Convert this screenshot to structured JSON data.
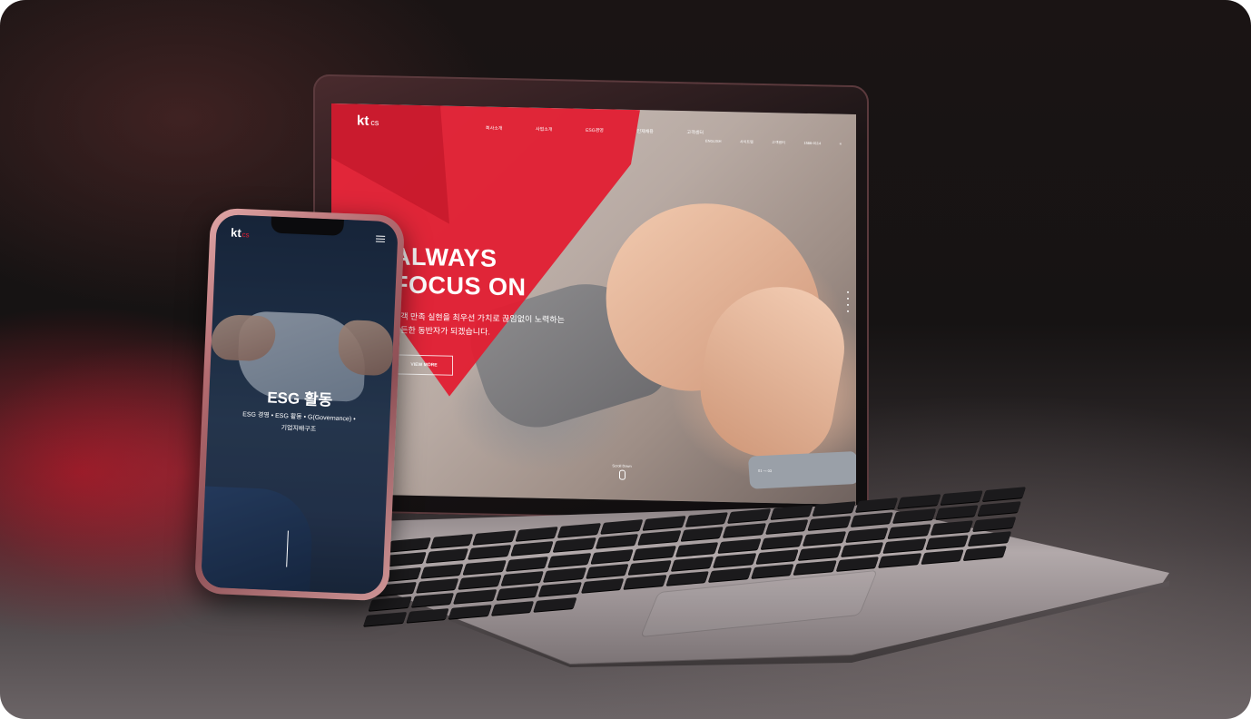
{
  "laptop_site": {
    "logo_kt": "kt",
    "logo_cs": "cs",
    "nav": [
      "회사소개",
      "사업소개",
      "ESG경영",
      "인재채용",
      "고객센터"
    ],
    "util": [
      "ENGLISH",
      "사이트맵",
      "고객센터",
      "1588-0114",
      "≡"
    ],
    "headline_1": "ALWAYS",
    "headline_2": "FOCUS ON",
    "sub_1": "고객 만족 실현을 최우선 가치로 끊임없이 노력하는",
    "sub_2": "든든한 동반자가 되겠습니다.",
    "cta_label": "VIEW MORE",
    "scroll_label": "Scroll Down",
    "slide_counter": "01 — 03"
  },
  "phone_site": {
    "logo_kt": "kt",
    "logo_cs": "cs",
    "title": "ESG 활동",
    "links_1": "ESG 경영 • ESG 활동 • G(Governance) •",
    "links_2": "기업지배구조"
  },
  "colors": {
    "brand_red": "#e11d31",
    "background": "#161313"
  },
  "icons": [
    "hamburger-menu-icon",
    "mouse-scroll-icon"
  ]
}
